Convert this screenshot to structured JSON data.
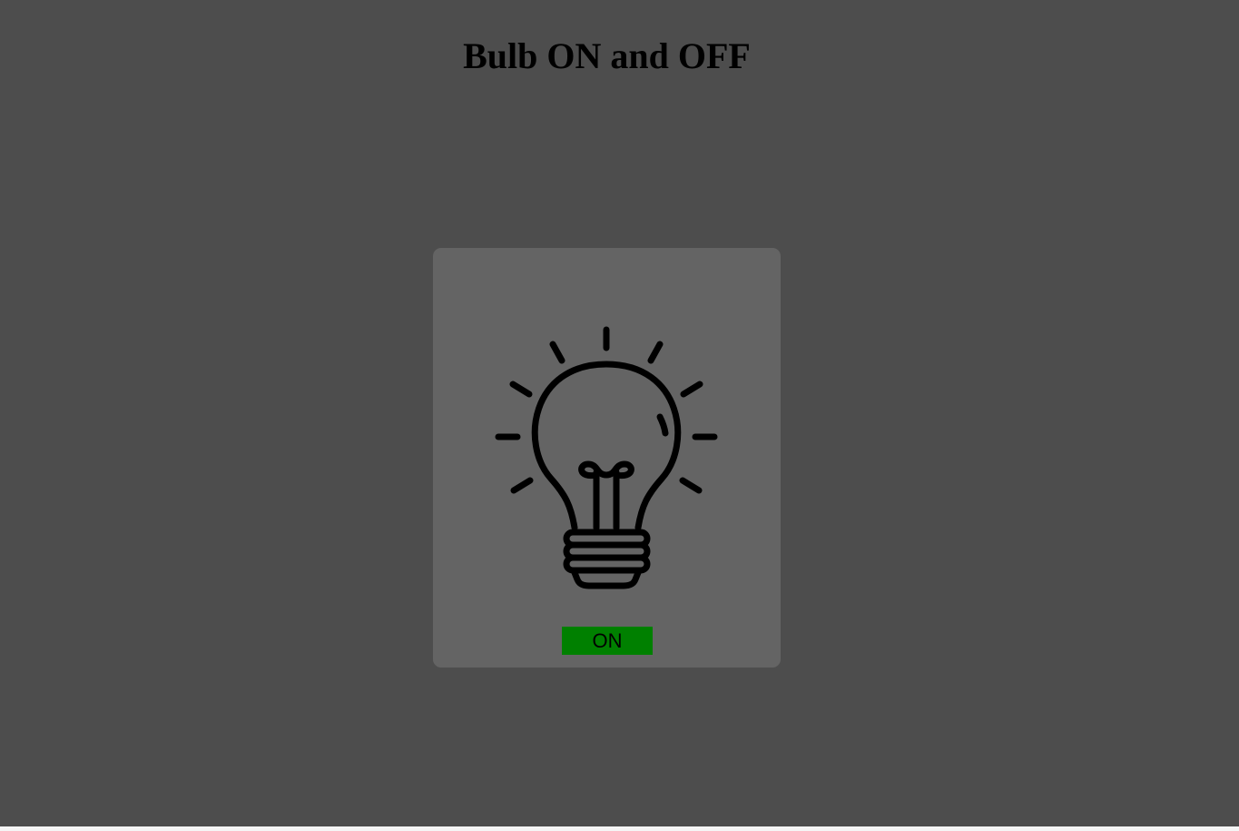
{
  "page": {
    "title": "Bulb ON and OFF",
    "background_color": "#4d4d4d"
  },
  "card": {
    "background_color": "#646464",
    "bulb_icon": "lightbulb-icon",
    "bulb_state": "off",
    "toggle_button": {
      "label": "ON",
      "background_color": "#008000"
    }
  }
}
